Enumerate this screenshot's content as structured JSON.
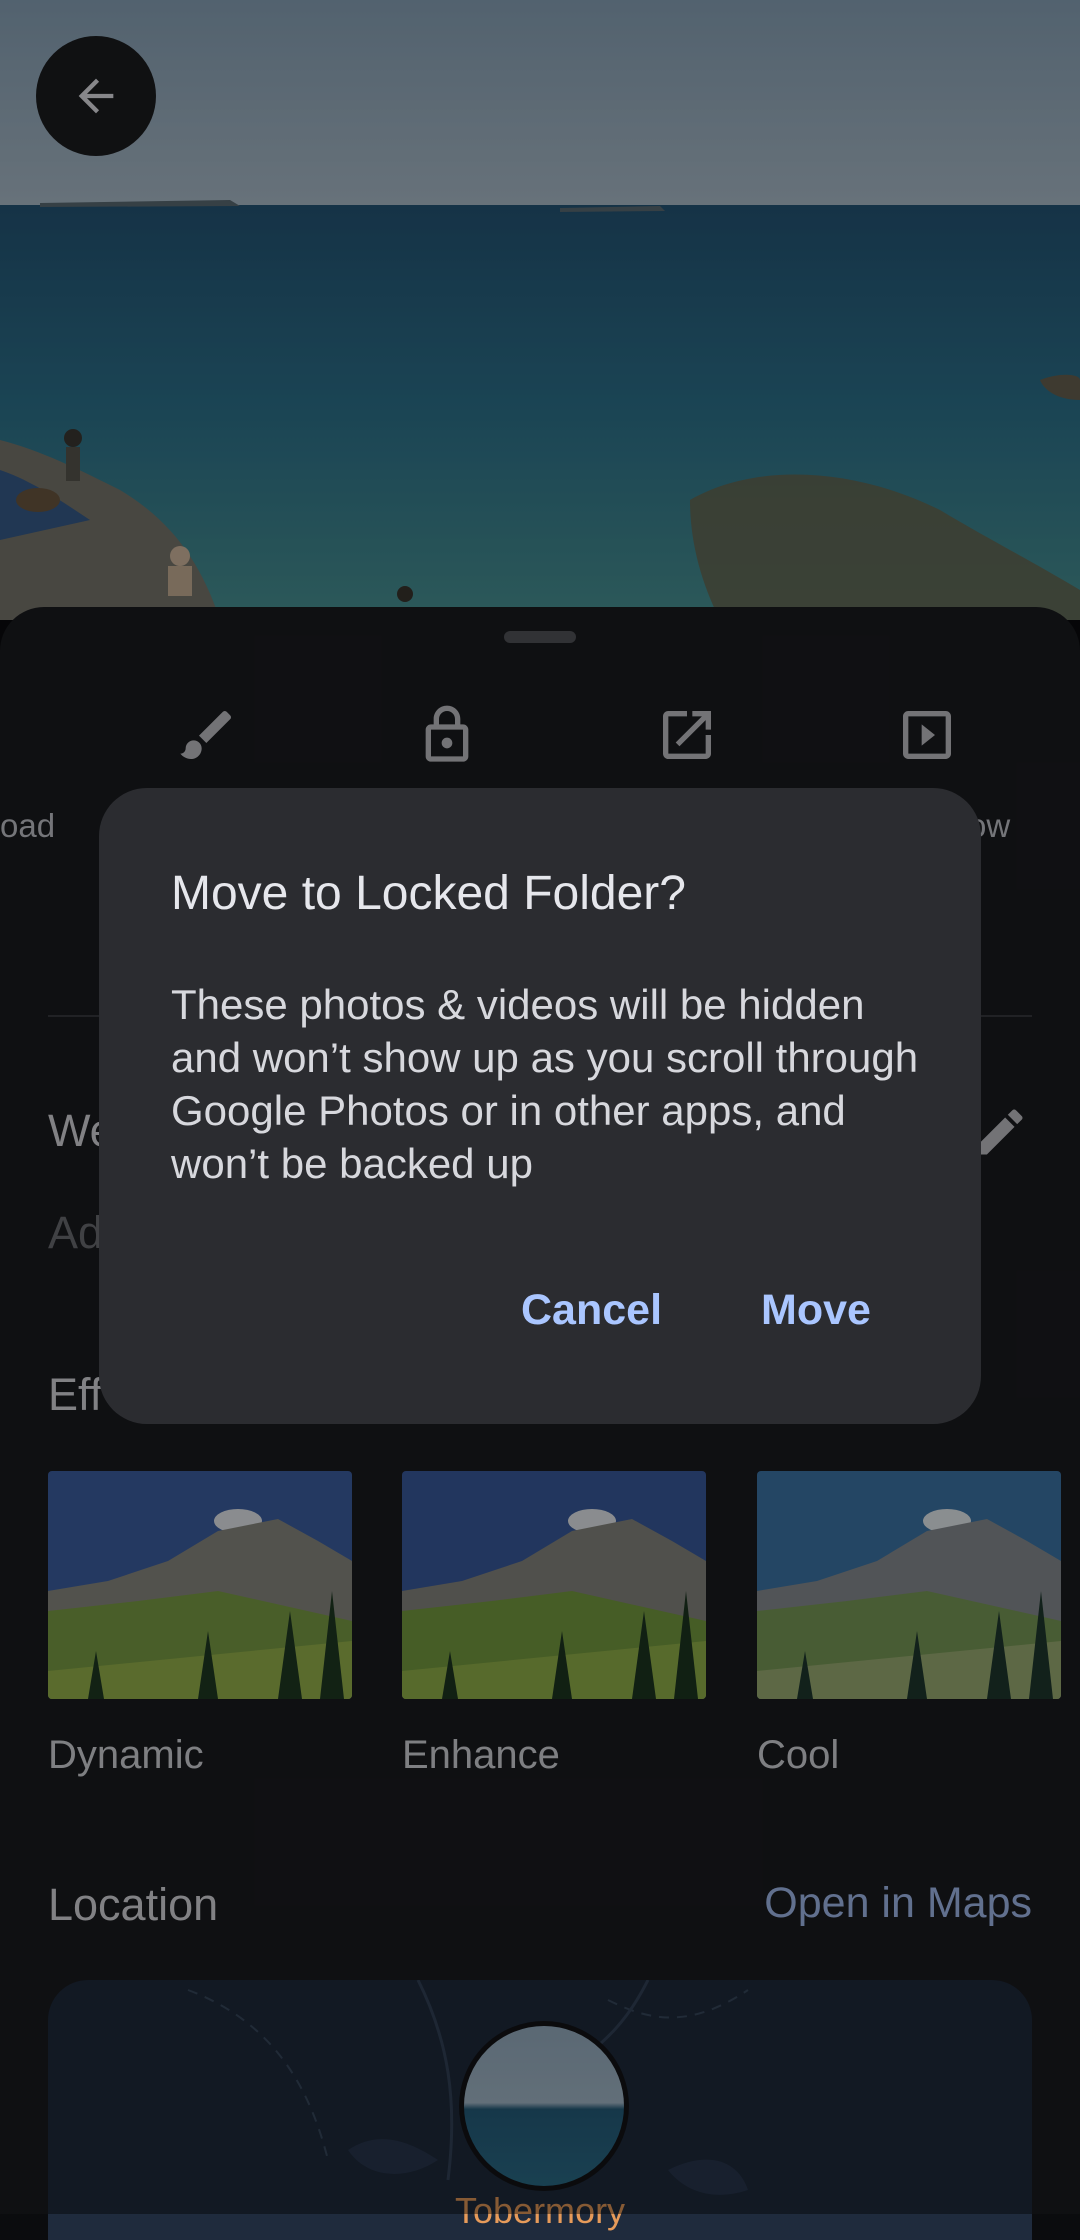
{
  "back_button": {
    "icon": "arrow-back-icon"
  },
  "actions": [
    {
      "icon": "brush-icon"
    },
    {
      "icon": "lock-icon"
    },
    {
      "icon": "open-external-icon"
    },
    {
      "icon": "slideshow-play-icon"
    }
  ],
  "partial_labels": {
    "left": "oad",
    "right": "ow"
  },
  "details": {
    "title_partial": "We",
    "add_description_partial": "Ad"
  },
  "effects": {
    "title_partial": "Eff",
    "items": [
      {
        "label": "Dynamic"
      },
      {
        "label": "Enhance"
      },
      {
        "label": "Cool"
      }
    ]
  },
  "location": {
    "title": "Location",
    "open_maps": "Open in Maps",
    "place": "Tobermory"
  },
  "dialog": {
    "title": "Move to Locked Folder?",
    "body": "These photos & videos will be hidden and won’t show up as you scroll through Google Photos or in other apps, and won’t be backed up",
    "cancel": "Cancel",
    "confirm": "Move"
  },
  "colors": {
    "sheet": "#1b1c20",
    "dialog": "#2b2c30",
    "accent": "#aac6ff",
    "map_label": "#e79b5a"
  }
}
